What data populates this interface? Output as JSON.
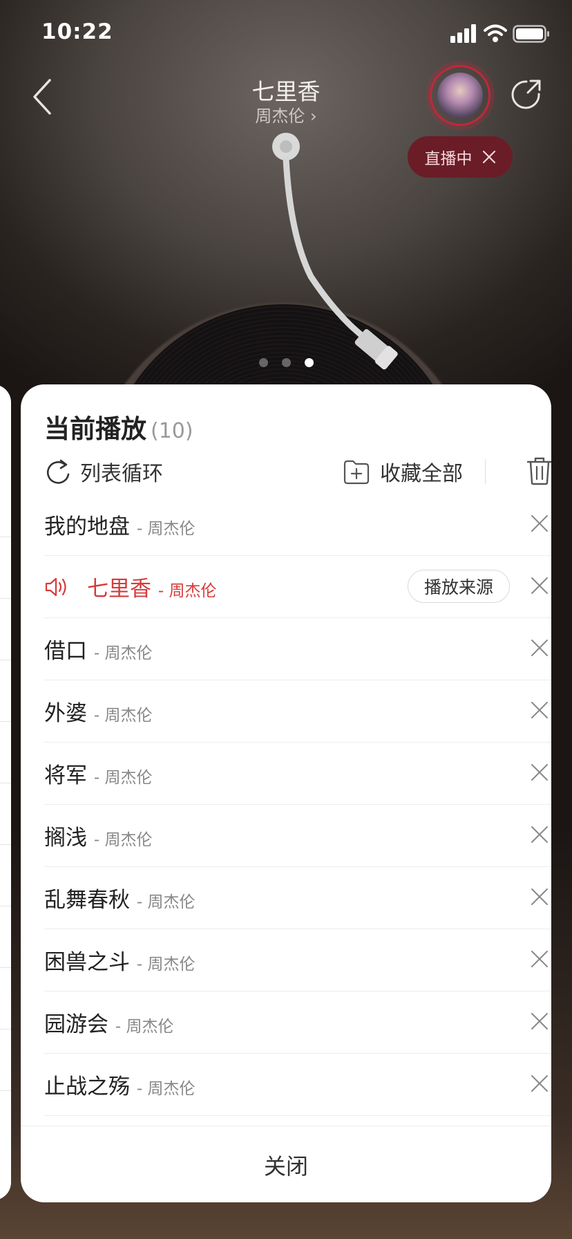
{
  "status_bar": {
    "time": "10:22"
  },
  "header": {
    "title": "七里香",
    "subtitle": "周杰伦 ›",
    "live_badge": "直播中"
  },
  "pager": {
    "count": 3,
    "active_index": 2
  },
  "playlist": {
    "title": "当前播放",
    "count": "(10)",
    "loop_label": "列表循环",
    "collect_label": "收藏全部",
    "source_button": "播放来源",
    "close_label": "关闭",
    "items": [
      {
        "song": "我的地盘",
        "artist": "- 周杰伦",
        "playing": false
      },
      {
        "song": "七里香",
        "artist": "- 周杰伦",
        "playing": true
      },
      {
        "song": "借口",
        "artist": "- 周杰伦",
        "playing": false
      },
      {
        "song": "外婆",
        "artist": "- 周杰伦",
        "playing": false
      },
      {
        "song": "将军",
        "artist": "- 周杰伦",
        "playing": false
      },
      {
        "song": "搁浅",
        "artist": "- 周杰伦",
        "playing": false
      },
      {
        "song": "乱舞春秋",
        "artist": "- 周杰伦",
        "playing": false
      },
      {
        "song": "困兽之斗",
        "artist": "- 周杰伦",
        "playing": false
      },
      {
        "song": "园游会",
        "artist": "- 周杰伦",
        "playing": false
      },
      {
        "song": "止战之殇",
        "artist": "- 周杰伦",
        "playing": false
      }
    ]
  },
  "colors": {
    "accent": "#d53b3b",
    "live_pill": "#6a1d27",
    "ring": "#c0283a"
  }
}
